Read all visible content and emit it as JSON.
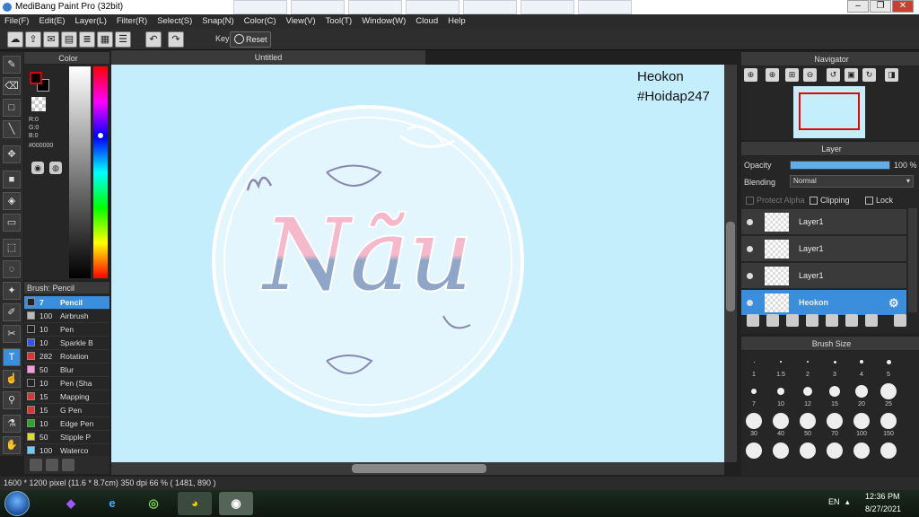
{
  "window": {
    "title": "MediBang Paint Pro (32bit)",
    "controls": [
      "–",
      "❐",
      "✕"
    ]
  },
  "menu": [
    "File(F)",
    "Edit(E)",
    "Layer(L)",
    "Filter(R)",
    "Select(S)",
    "Snap(N)",
    "Color(C)",
    "View(V)",
    "Tool(T)",
    "Window(W)",
    "Cloud",
    "Help"
  ],
  "toolbar": {
    "key_label": "Key",
    "reset_label": "Reset"
  },
  "color_panel": {
    "title": "Color",
    "r": "R:0",
    "g": "G:0",
    "b": "B:0",
    "hex": "#000000",
    "fg": "#000000"
  },
  "brush_panel": {
    "title": "Brush: Pencil",
    "items": [
      {
        "size": "7",
        "name": "Pencil",
        "color": "#222222"
      },
      {
        "size": "100",
        "name": "Airbrush",
        "color": "#bbbbbb"
      },
      {
        "size": "10",
        "name": "Pen",
        "color": "#222222"
      },
      {
        "size": "10",
        "name": "Sparkle B",
        "color": "#3355ee"
      },
      {
        "size": "282",
        "name": "Rotation",
        "color": "#dd3333"
      },
      {
        "size": "50",
        "name": "Blur",
        "color": "#ff99dd"
      },
      {
        "size": "10",
        "name": "Pen (Sha",
        "color": "#222222"
      },
      {
        "size": "15",
        "name": "Mapping",
        "color": "#dd3333"
      },
      {
        "size": "15",
        "name": "G Pen",
        "color": "#dd3333"
      },
      {
        "size": "10",
        "name": "Edge Pen",
        "color": "#22aa22"
      },
      {
        "size": "50",
        "name": "Stipple P",
        "color": "#dddd22"
      },
      {
        "size": "100",
        "name": "Waterco",
        "color": "#66ccff"
      }
    ]
  },
  "document": {
    "tab": "Untitled",
    "watermark_line1": "Heokon",
    "watermark_line2": "#Hoidap247",
    "artwork_text": "Nãu"
  },
  "navigator": {
    "title": "Navigator"
  },
  "layer_panel": {
    "title": "Layer",
    "opacity_label": "Opacity",
    "opacity_value": "100 %",
    "opacity_fraction": 1.0,
    "blending_label": "Blending",
    "blending_value": "Normal",
    "protect_alpha": "Protect Alpha",
    "clipping": "Clipping",
    "lock": "Lock",
    "layers": [
      {
        "name": "Layer1",
        "selected": false
      },
      {
        "name": "Layer1",
        "selected": false
      },
      {
        "name": "Layer1",
        "selected": false
      },
      {
        "name": "Heokon",
        "selected": true
      }
    ]
  },
  "brush_size_panel": {
    "title": "Brush Size",
    "sizes": [
      "1",
      "1.5",
      "2",
      "3",
      "4",
      "5",
      "7",
      "10",
      "12",
      "15",
      "20",
      "25",
      "30",
      "40",
      "50",
      "70",
      "100",
      "150"
    ]
  },
  "status": {
    "text": "1600 * 1200 pixel  (11.6 * 8.7cm)  350 dpi  66 %  ( 1481, 890 )"
  },
  "taskbar": {
    "lang": "EN",
    "time": "12:36 PM",
    "date": "8/27/2021"
  }
}
